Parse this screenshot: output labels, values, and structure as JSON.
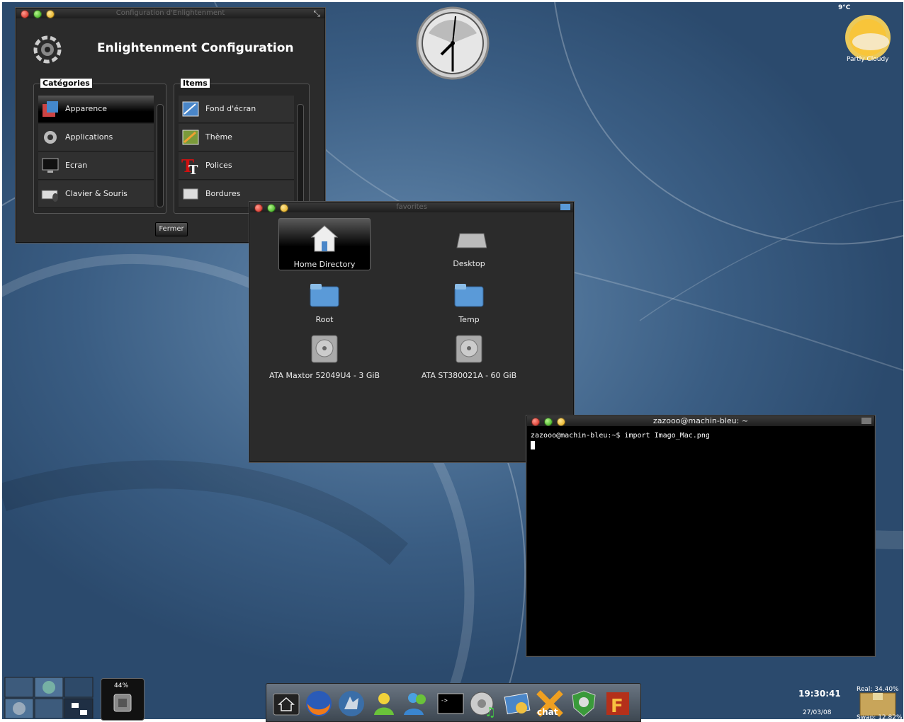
{
  "config_window": {
    "title": "Configuration d'Enlightenment",
    "heading": "Enlightenment Configuration",
    "categories_label": "Catégories",
    "items_label": "Items",
    "categories": [
      "Apparence",
      "Applications",
      "Ecran",
      "Clavier & Souris"
    ],
    "items": [
      "Fond d'écran",
      "Thème",
      "Polices",
      "Bordures"
    ],
    "close_button": "Fermer"
  },
  "favorites_window": {
    "title": "favorites",
    "entries": [
      "Home Directory",
      "Desktop",
      "Root",
      "Temp",
      "ATA Maxtor 52049U4 - 3 GiB",
      "ATA ST380021A - 60 GiB"
    ]
  },
  "terminal": {
    "title": "zazooo@machin-bleu: ~",
    "prompt_line": "zazooo@machin-bleu:~$ import Imago_Mac.png"
  },
  "weather": {
    "temperature": "9°C",
    "condition": "Partly Cloudy"
  },
  "cpu_gadget": {
    "usage": "44%"
  },
  "clock": {
    "time": "19:30:41",
    "date": "27/03/08"
  },
  "memory": {
    "real": "Real: 34.40%",
    "swap": "Swap: 12.82%"
  },
  "dock": {
    "icons": [
      "home-icon",
      "firefox-icon",
      "wolf-icon",
      "user-icon",
      "messenger-icon",
      "terminal-icon",
      "audio-player-icon",
      "image-viewer-icon",
      "chat-icon",
      "antivirus-icon",
      "filezilla-icon"
    ],
    "bg_color": "#56616d"
  },
  "colors": {
    "window_bg": "#2b2b2b",
    "desktop_blue": "#4f7398"
  }
}
